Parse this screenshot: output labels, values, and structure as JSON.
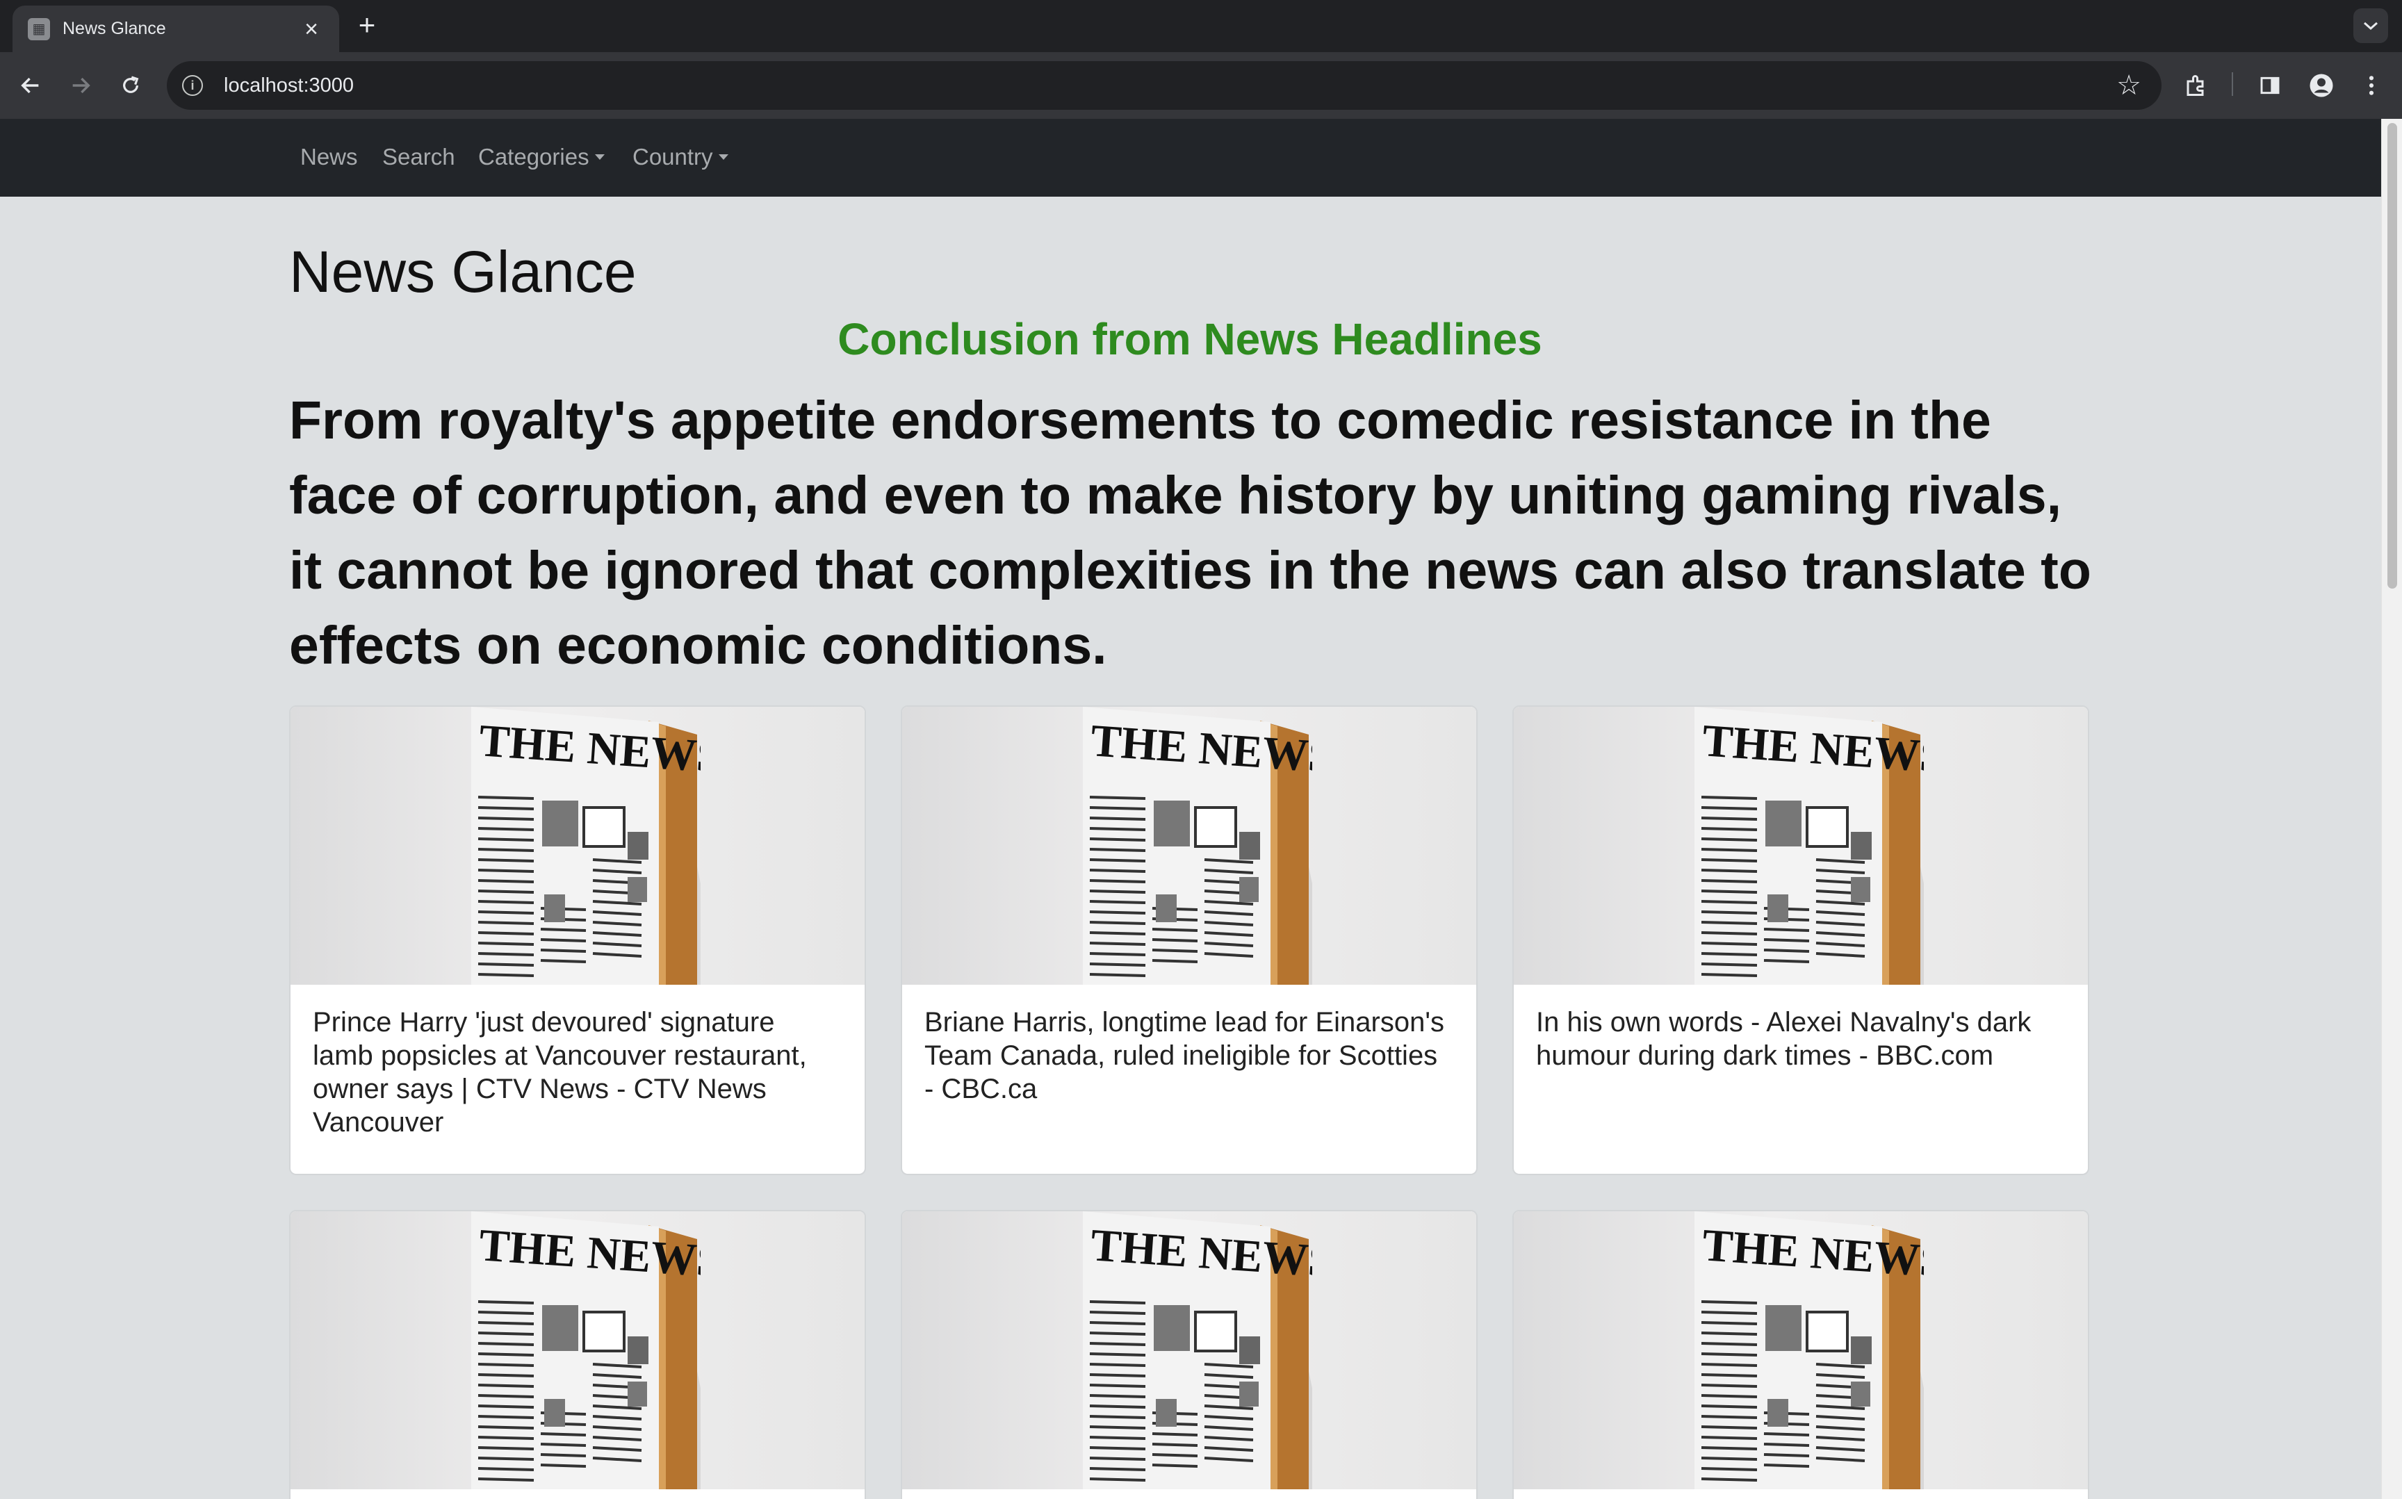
{
  "browser": {
    "tab_title": "News Glance",
    "url": "localhost:3000"
  },
  "nav": {
    "items": [
      {
        "label": "News"
      },
      {
        "label": "Search"
      },
      {
        "label": "Categories"
      },
      {
        "label": "Country"
      }
    ]
  },
  "page": {
    "title": "News Glance",
    "conclusion_title": "Conclusion from News Headlines",
    "conclusion_text": "From royalty's appetite endorsements to comedic resistance in the face of corruption, and even to make history by uniting gaming rivals, it cannot be ignored that complexities in the news can also translate to effects on economic conditions."
  },
  "articles": [
    {
      "title": "Prince Harry 'just devoured' signature lamb popsicles at Vancouver restaurant, owner says | CTV News - CTV News Vancouver",
      "image_label": "THE NEWS"
    },
    {
      "title": "Briane Harris, longtime lead for Einarson's Team Canada, ruled ineligible for Scotties - CBC.ca",
      "image_label": "THE NEWS"
    },
    {
      "title": "In his own words - Alexei Navalny's dark humour during dark times - BBC.com",
      "image_label": "THE NEWS"
    },
    {
      "title": "",
      "image_label": "THE NEWS"
    },
    {
      "title": "",
      "image_label": "THE NEWS"
    },
    {
      "title": "",
      "image_label": "THE NEWS"
    }
  ],
  "colors": {
    "accent_green": "#2e8b1f",
    "navbar": "#222529",
    "page_bg": "#dde0e2"
  }
}
